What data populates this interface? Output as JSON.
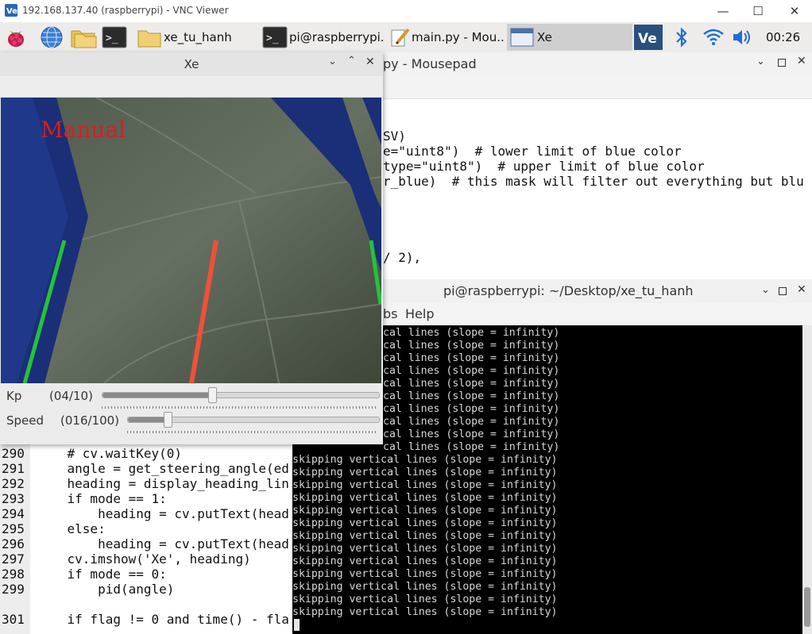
{
  "vnc": {
    "title": "192.168.137.40 (raspberrypi) - VNC Viewer",
    "minimize": "—",
    "maximize": "☐",
    "close": "✕"
  },
  "taskbar": {
    "apps": [
      {
        "label": "xe_tu_hanh"
      },
      {
        "label": "pi@raspberrypi..."
      },
      {
        "label": "main.py - Mou..."
      },
      {
        "label": "Xe"
      }
    ],
    "clock": "00:26"
  },
  "editor": {
    "title": "main.py - Mousepad",
    "title_visible": "py - Mousepad",
    "top_lines": [
      "SV)",
      "e=\"uint8\")  # lower limit of blue color",
      "type=\"uint8\")  # upper limit of blue color",
      "r_blue)  # this mask will filter out everything but blu",
      "/ 2),"
    ],
    "line_numbers": [
      "290",
      "291",
      "292",
      "293",
      "294",
      "295",
      "296",
      "297",
      "298",
      "299",
      "",
      "301"
    ],
    "bottom_lines": [
      "    # cv.waitKey(0)",
      "    angle = get_steering_angle(ed",
      "    heading = display_heading_lin",
      "    if mode == 1:",
      "        heading = cv.putText(head",
      "    else:",
      "        heading = cv.putText(head",
      "    cv.imshow('Xe', heading)",
      "    if mode == 0:",
      "        pid(angle)",
      "",
      "    if flag != 0 and time() - fla"
    ]
  },
  "terminal": {
    "title": "pi@raspberrypi: ~/Desktop/xe_tu_hanh",
    "menu_partial": "bs",
    "menu_help": "Help",
    "first_partial": "cal lines (slope = infinity)",
    "line_text": "skipping vertical lines (slope = infinity)"
  },
  "xe": {
    "title": "Xe",
    "overlay_text": "Manual",
    "kp_label": "Kp",
    "kp_value": "(04/10)",
    "kp_fraction": 0.4,
    "speed_label": "Speed",
    "speed_value": "(016/100)",
    "speed_fraction": 0.16
  },
  "colors": {
    "left_line": "#22c33b",
    "center_line": "#f0503a",
    "right_line": "#22c33b",
    "tape": "#1b2e78",
    "overlay_text": "#d61f1f"
  }
}
